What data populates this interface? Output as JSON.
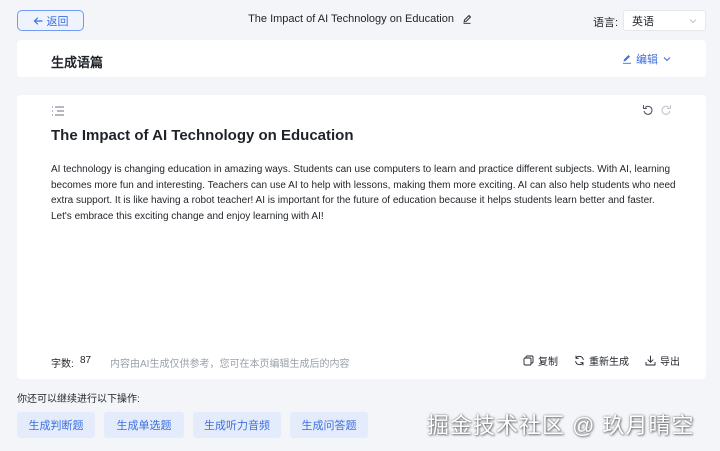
{
  "header": {
    "back_label": "返回",
    "document_title": "The Impact of AI Technology on Education",
    "language_label": "语言:",
    "language_value": "英语"
  },
  "section": {
    "title": "生成语篇",
    "edit_label": "编辑"
  },
  "article": {
    "title": "The Impact of AI Technology on Education",
    "body": "AI technology is changing education in amazing ways. Students can use computers to learn and practice different subjects. With AI, learning becomes more fun and interesting. Teachers can use AI to help with lessons, making them more exciting. AI can also help students who need extra support. It is like having a robot teacher! AI is important for the future of education because it helps students learn better and faster. Let's embrace this exciting change and enjoy learning with AI!"
  },
  "footer": {
    "word_count_label": "字数:",
    "word_count_value": "87",
    "disclaimer": "内容由AI生成仅供参考，您可在本页编辑生成后的内容",
    "copy_label": "复制",
    "regenerate_label": "重新生成",
    "export_label": "导出"
  },
  "more": {
    "label": "你还可以继续进行以下操作:",
    "actions": [
      "生成判断题",
      "生成单选题",
      "生成听力音频",
      "生成问答题"
    ]
  },
  "watermark": "掘金技术社区 @ 玖月晴空",
  "colors": {
    "accent": "#3d6fe0",
    "chip_bg": "#e4ecfb",
    "page_bg": "#f3f5f9"
  }
}
